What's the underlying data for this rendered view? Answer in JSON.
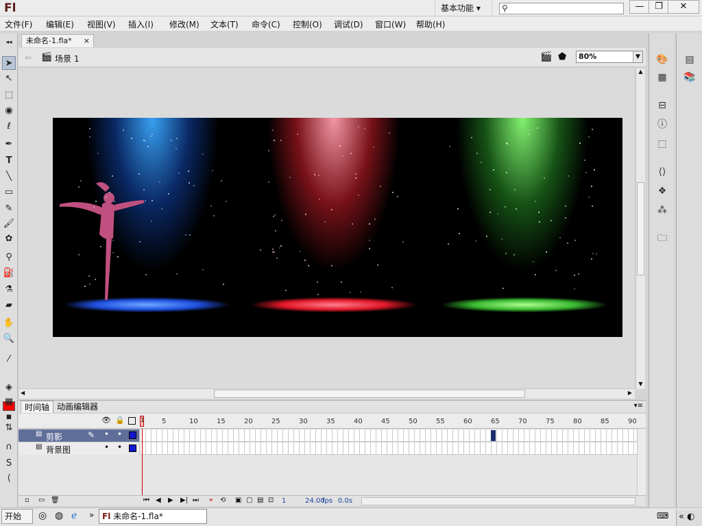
{
  "app": {
    "logo": "Fl",
    "workspace": "基本功能",
    "search_placeholder": ""
  },
  "window_controls": {
    "minimize": "—",
    "restore": "❐",
    "close": "✕"
  },
  "menu": [
    "文件(F)",
    "编辑(E)",
    "视图(V)",
    "插入(I)",
    "修改(M)",
    "文本(T)",
    "命令(C)",
    "控制(O)",
    "调试(D)",
    "窗口(W)",
    "帮助(H)"
  ],
  "document": {
    "tab": "未命名-1.fla*",
    "tab_close": "×",
    "scene": "场景 1",
    "zoom": "80%"
  },
  "timeline": {
    "tabs": [
      "时间轴",
      "动画编辑器"
    ],
    "frame_numbers": [
      "1",
      "5",
      "10",
      "15",
      "20",
      "25",
      "30",
      "35",
      "40",
      "45",
      "50",
      "55",
      "60",
      "65",
      "70",
      "75",
      "80",
      "85",
      "90"
    ],
    "layers": [
      {
        "name": "剪影",
        "selected": true,
        "keyframe_end": 65
      },
      {
        "name": "背景图",
        "selected": false
      }
    ],
    "current_frame": "1",
    "fps": "24.00",
    "fps_unit": "fps",
    "time": "0.0s"
  },
  "stage_colors": {
    "blue": "#2a8ce8",
    "red": "#e83040",
    "green": "#4ed040"
  },
  "tool_color": "#ff0000",
  "taskbar": {
    "start": "开始",
    "app": "未命名-1.fla*"
  }
}
